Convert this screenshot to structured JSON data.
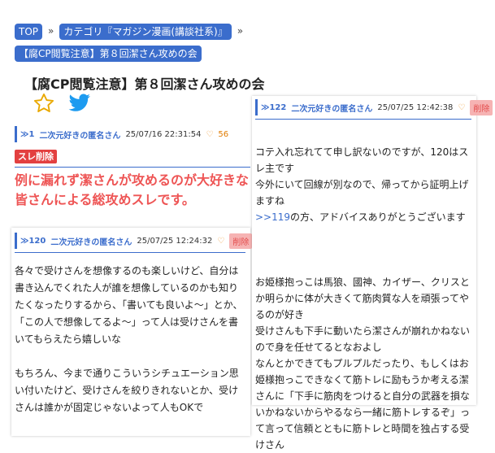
{
  "breadcrumbs": {
    "top": "TOP",
    "separator": "»",
    "category": "カテゴリ『マガジン漫画(講談社系)』",
    "thread": "【腐CP閲覧注意】第８回潔さん攻めの会"
  },
  "thread": {
    "title": "【腐CP閲覧注意】第８回潔さん攻めの会"
  },
  "posts": {
    "p1": {
      "num": "≫1",
      "name": "二次元好きの匿名さん",
      "date": "25/07/16 22:31:54",
      "likes": "56",
      "delete_label": "スレ削除",
      "body": "例に漏れず潔さんが攻めるのが大好きな皆さんによる総攻めスレです。"
    },
    "p120": {
      "num": "≫120",
      "name": "二次元好きの匿名さん",
      "date": "25/07/25 12:24:32",
      "delete_label": "削除",
      "body": "各々で受けさんを想像するのも楽しいけど、自分は書き込んでくれた人が誰を想像しているのかも知りたくなったりするから、「書いても良いよ〜」とか、「この人で想像してるよ〜」って人は受けさんを書いてもらえたら嬉しいな\n\nもちろん、今まで通りこういうシチュエーション思い付いたけど、受けさんを絞りきれないとか、受けさんは誰かが固定じゃないよって人もOKで"
    },
    "p122": {
      "num": "≫122",
      "name": "二次元好きの匿名さん",
      "date": "25/07/25 12:42:38",
      "delete_label": "削除",
      "body_1": "コテ入れ忘れてて申し訳ないのですが、120はスレ主です\n今外にいて回線が別なので、帰ってから証明上げますね",
      "reply_link": ">>119",
      "body_2": "の方、アドバイスありがとうございます",
      "body_3": "お姫様抱っこは馬狼、國神、カイザー、クリスとか明らかに体が大きくて筋肉質な人を頑張ってやるのが好き\n受けさんも下手に動いたら潔さんが崩れかねないので身を任せてるとなおよし\nなんとかできてもプルプルだったり、もしくはお姫様抱っこできなくて筋トレに励もうか考える潔さんに「下手に筋肉をつけると自分の武器を損ないかねないからやるなら一緒に筋トレするぞ」って言って信頼とともに筋トレと時間を独占する受けさん"
    }
  },
  "colors": {
    "accent": "#3b6dcc",
    "delete_bg": "#e34040",
    "highlight_text": "#ee5555"
  }
}
